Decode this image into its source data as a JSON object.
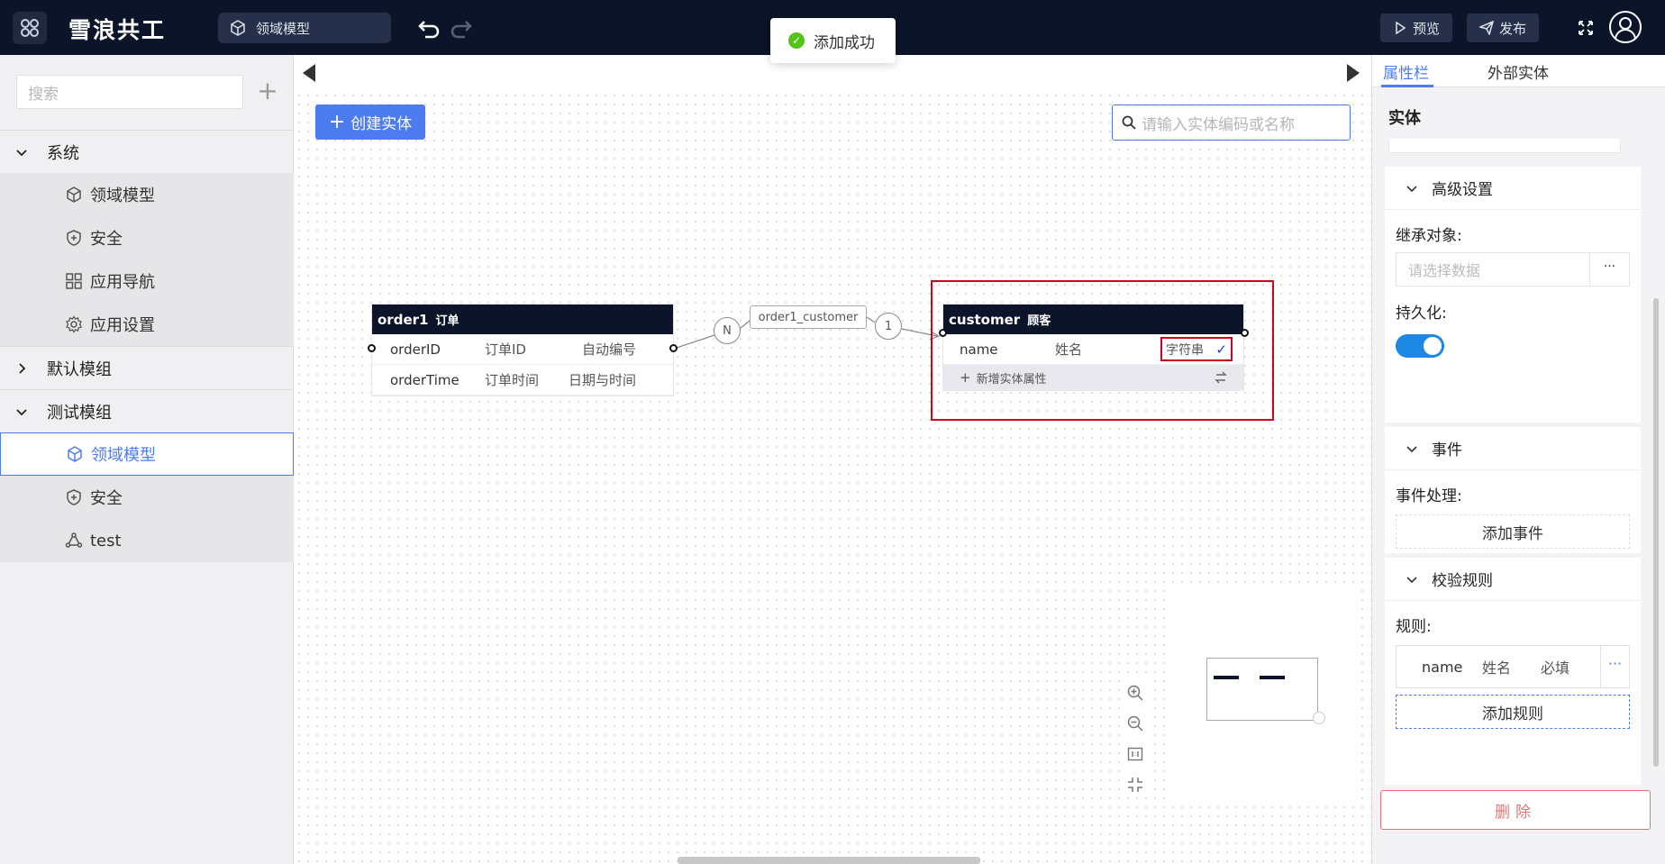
{
  "header": {
    "app_title": "雪浪共工",
    "model_selector": "领域模型",
    "preview_label": "预览",
    "publish_label": "发布"
  },
  "toast": {
    "message": "添加成功",
    "type": "success"
  },
  "sidebar": {
    "search_placeholder": "搜索",
    "groups": [
      {
        "label": "系统",
        "expanded": true,
        "items": [
          {
            "label": "领域模型",
            "icon": "cube-icon"
          },
          {
            "label": "安全",
            "icon": "shield-icon"
          },
          {
            "label": "应用导航",
            "icon": "grid-icon"
          },
          {
            "label": "应用设置",
            "icon": "gear-icon"
          }
        ]
      },
      {
        "label": "默认模组",
        "expanded": false,
        "items": []
      },
      {
        "label": "测试模组",
        "expanded": true,
        "items": [
          {
            "label": "领域模型",
            "icon": "cube-icon",
            "selected": true
          },
          {
            "label": "安全",
            "icon": "shield-icon"
          },
          {
            "label": "test",
            "icon": "nodes-icon"
          }
        ]
      }
    ]
  },
  "canvas": {
    "create_entity_label": "创建实体",
    "entity_search_placeholder": "请输入实体编码或名称",
    "entities": [
      {
        "code": "order1",
        "name": "订单",
        "rows": [
          {
            "field": "orderID",
            "label": "订单ID",
            "type": "自动编号"
          },
          {
            "field": "orderTime",
            "label": "订单时间",
            "type": "日期与时间"
          }
        ]
      },
      {
        "code": "customer",
        "name": "顾客",
        "rows": [
          {
            "field": "name",
            "label": "姓名",
            "type": "字符串",
            "check": "✓"
          }
        ],
        "add_attr_label": "新增实体属性"
      }
    ],
    "relation": {
      "name": "order1_customer",
      "from_card": "N",
      "to_card": "1"
    }
  },
  "right_panel": {
    "tabs": [
      "属性栏",
      "外部实体"
    ],
    "active_tab": "属性栏",
    "section_title": "实体",
    "advanced": {
      "title": "高级设置",
      "inherit_label": "继承对象:",
      "inherit_placeholder": "请选择数据",
      "more": "···",
      "persist_label": "持久化:",
      "persist_on": true
    },
    "events": {
      "title": "事件",
      "handler_label": "事件处理:",
      "add_event_label": "添加事件"
    },
    "validation": {
      "title": "校验规则",
      "rules_label": "规则:",
      "rule": {
        "field": "name",
        "label": "姓名",
        "rule": "必填"
      },
      "more": "···",
      "add_rule_label": "添加规则"
    },
    "delete_label": "删除"
  },
  "colors": {
    "topbar": "#0b1428",
    "accent": "#4d7cf0",
    "success": "#52c41a",
    "danger": "#e57373",
    "highlight": "#d0021b"
  }
}
